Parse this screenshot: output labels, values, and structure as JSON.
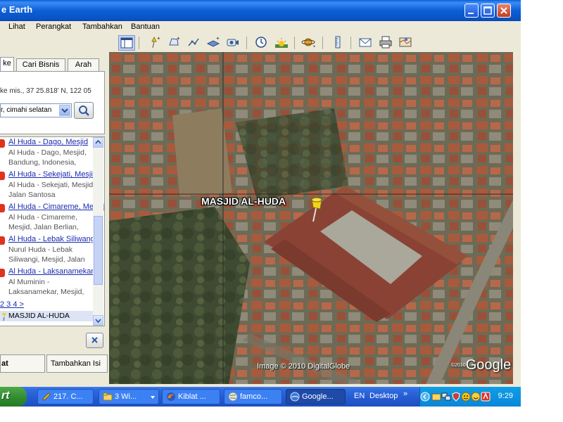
{
  "window": {
    "title": "e Earth"
  },
  "menu": [
    "Lihat",
    "Perangkat",
    "Tambahkan",
    "Bantuan"
  ],
  "left_panel": {
    "tabs": [
      "ke",
      "Cari Bisnis",
      "Arah"
    ],
    "coords": "ke mis., 37 25.818' N, 122 05",
    "search_value": "r, cimahi selatan",
    "results": [
      {
        "name": "Al Huda - Dago, Mesjid",
        "desc": "Al Huda - Dago, Mesjid, Bandung, Indonesia,"
      },
      {
        "name": "Al Huda - Sekejati, Mesjid",
        "desc": "Al Huda - Sekejati, Mesjid, Jalan Santosa"
      },
      {
        "name": "Al Huda - Cimareme, Mesjid",
        "desc": "Al Huda - Cimareme, Mesjid, Jalan Berlian,"
      },
      {
        "name": "Al Huda - Lebak Siliwangi",
        "desc": "Nurul Huda - Lebak Siliwangi, Mesjid, Jalan"
      },
      {
        "name": "Al Huda - Laksanamekar,",
        "desc": "Al Muminin - Laksanamekar, Mesjid,"
      }
    ],
    "pages": "2 3 4 >",
    "selected_place": "MASJID AL-HUDA",
    "bottom_tabs": [
      "at",
      "Tambahkan Isi"
    ]
  },
  "map": {
    "placemark_label": "MASJID AL-HUDA",
    "copyright": "Image © 2010 DigitalGlobe",
    "logo_small": "©2010",
    "logo": "Google"
  },
  "taskbar": {
    "start": "rt",
    "tasks": [
      {
        "label": "217. C..."
      },
      {
        "label": "3 Wi..."
      },
      {
        "label": "Kiblat ..."
      },
      {
        "label": "famco..."
      },
      {
        "label": "Google..."
      }
    ],
    "lang": "EN",
    "desktop": "Desktop",
    "chevron": "»",
    "clock": "9:29"
  },
  "colors": {
    "titlebar": "#0a5fd8",
    "taskbar": "#245ad0",
    "start": "#2f8a2f",
    "link": "#1a2bb0",
    "pin": "#e0321e"
  }
}
